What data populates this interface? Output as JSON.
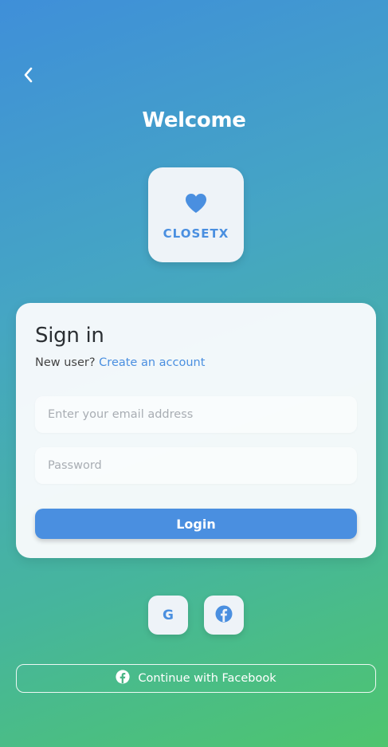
{
  "header": {
    "title": "Welcome"
  },
  "logo": {
    "icon": "heart-icon",
    "text": "CLOSETX"
  },
  "signin": {
    "title": "Sign in",
    "new_user_prefix": "New user?",
    "create_account_link": "Create an account",
    "email_placeholder": "Enter your email address",
    "password_placeholder": "Password",
    "login_label": "Login"
  },
  "social": {
    "google_letter": "G",
    "facebook_icon": "facebook-icon",
    "continue_facebook_label": "Continue with Facebook"
  },
  "colors": {
    "accent": "#4a8fe0",
    "gradient_top": "#3f8fd9",
    "gradient_bottom": "#4ec56e",
    "card_bg": "#f8fafc"
  }
}
